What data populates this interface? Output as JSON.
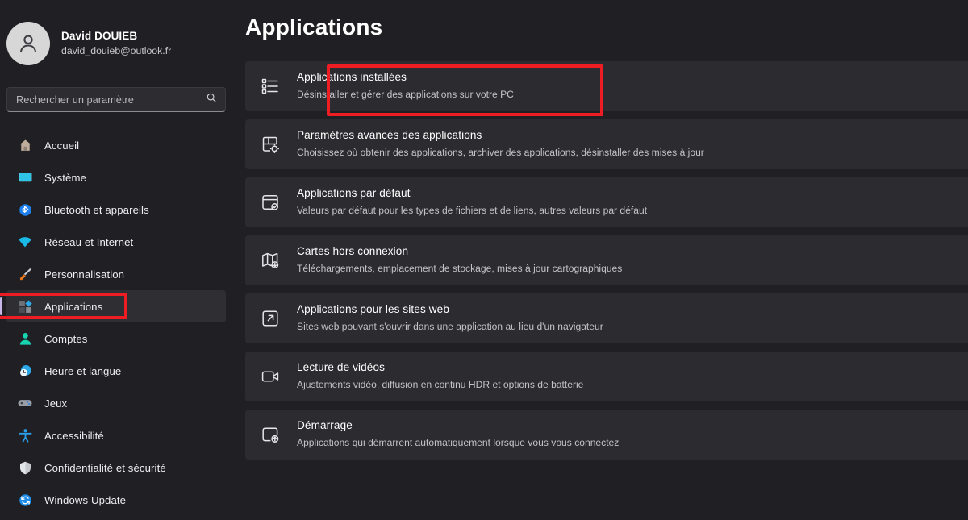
{
  "accent": {
    "selection_pill": "#c9b6e8",
    "annotation_red": "#ee1c23"
  },
  "profile": {
    "name": "David DOUIEB",
    "email": "david_douieb@outlook.fr",
    "avatar_icon": "person-avatar-icon"
  },
  "search": {
    "placeholder": "Rechercher un paramètre",
    "value": "",
    "icon": "search-icon"
  },
  "sidebar": {
    "items": [
      {
        "label": "Accueil",
        "icon": "home-icon",
        "selected": false
      },
      {
        "label": "Système",
        "icon": "monitor-icon",
        "selected": false
      },
      {
        "label": "Bluetooth et appareils",
        "icon": "bluetooth-icon",
        "selected": false
      },
      {
        "label": "Réseau et Internet",
        "icon": "wifi-icon",
        "selected": false
      },
      {
        "label": "Personnalisation",
        "icon": "paintbrush-icon",
        "selected": false
      },
      {
        "label": "Applications",
        "icon": "apps-icon",
        "selected": true
      },
      {
        "label": "Comptes",
        "icon": "account-person-icon",
        "selected": false
      },
      {
        "label": "Heure et langue",
        "icon": "clock-globe-icon",
        "selected": false
      },
      {
        "label": "Jeux",
        "icon": "gamepad-icon",
        "selected": false
      },
      {
        "label": "Accessibilité",
        "icon": "accessibility-person-icon",
        "selected": false
      },
      {
        "label": "Confidentialité et sécurité",
        "icon": "shield-icon",
        "selected": false
      },
      {
        "label": "Windows Update",
        "icon": "update-refresh-icon",
        "selected": false
      }
    ]
  },
  "main": {
    "title": "Applications",
    "cards": [
      {
        "title": "Applications installées",
        "subtitle": "Désinstaller et gérer des applications sur votre PC",
        "icon": "list-apps-icon",
        "highlighted": true
      },
      {
        "title": "Paramètres avancés des applications",
        "subtitle": "Choisissez où obtenir des applications, archiver des applications, désinstaller des mises à jour",
        "icon": "app-settings-gear-icon",
        "highlighted": false
      },
      {
        "title": "Applications par défaut",
        "subtitle": "Valeurs par défaut pour les types de fichiers et de liens, autres valeurs par défaut",
        "icon": "default-apps-check-icon",
        "highlighted": false
      },
      {
        "title": "Cartes hors connexion",
        "subtitle": "Téléchargements, emplacement de stockage, mises à jour cartographiques",
        "icon": "map-download-icon",
        "highlighted": false
      },
      {
        "title": "Applications pour les sites web",
        "subtitle": "Sites web pouvant s'ouvrir dans une application au lieu d'un navigateur",
        "icon": "external-link-icon",
        "highlighted": false
      },
      {
        "title": "Lecture de vidéos",
        "subtitle": "Ajustements vidéo, diffusion en continu HDR et options de batterie",
        "icon": "video-camera-icon",
        "highlighted": false
      },
      {
        "title": "Démarrage",
        "subtitle": "Applications qui démarrent automatiquement lorsque vous vous connectez",
        "icon": "startup-upload-icon",
        "highlighted": false
      }
    ]
  }
}
